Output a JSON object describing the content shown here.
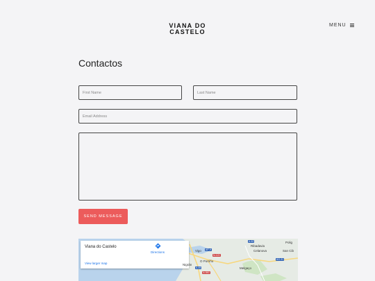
{
  "header": {
    "brand_line1": "VIANA DO",
    "brand_line2": "CASTELO",
    "menu_label": "MENU"
  },
  "page": {
    "title": "Contactos"
  },
  "form": {
    "first_name_placeholder": "First Name",
    "last_name_placeholder": "Last Name",
    "email_placeholder": "Email Address",
    "message_value": "",
    "submit_label": "SEND MESSAGE"
  },
  "map": {
    "place_name": "Viana do Castelo",
    "directions_label": "Directions",
    "larger_map_label": "View larger map",
    "labels": {
      "vigo": "Vigo",
      "ribadavia": "Ribadavia",
      "celanova": "Celanova",
      "porrino": "O Porriño",
      "melgaco": "Melgaço",
      "nigran": "Nigrán",
      "polig": "Polig",
      "san_cib": "San Cib"
    },
    "roads": {
      "ap9": "AP-9",
      "n120": "N-120",
      "a52": "A-52",
      "n550": "N-550",
      "a55": "A-55",
      "ag31": "AG-31"
    },
    "colors": {
      "land": "#e6ebe5",
      "water": "#b9d3ec",
      "park": "#cfe5c4",
      "road": "#f7d77e"
    }
  }
}
